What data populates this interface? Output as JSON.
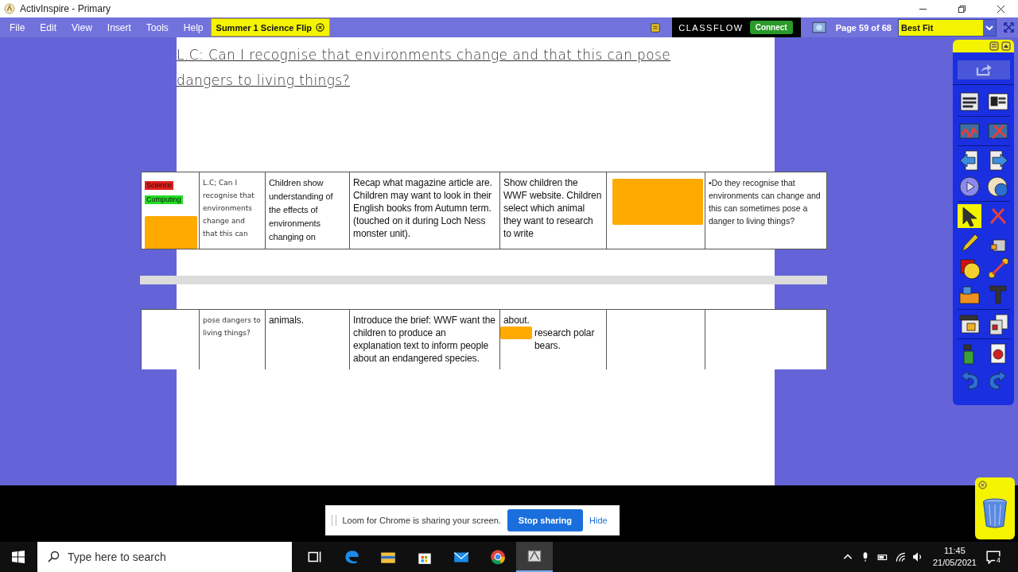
{
  "window": {
    "title": "ActivInspire - Primary"
  },
  "menu": [
    "File",
    "Edit",
    "View",
    "Insert",
    "Tools",
    "Help"
  ],
  "flipchart_tab": {
    "label": "Summer 1 Science Flip"
  },
  "classflow": {
    "logo": "CLASSFLOW",
    "button": "Connect"
  },
  "page_indicator": "Page 59 of 68",
  "zoom_select": {
    "value": "Best Fit"
  },
  "page": {
    "title_lines": [
      "L.C: Can I recognise that environments change and that this can pose",
      "dangers to living things? "
    ]
  },
  "tables": [
    {
      "cells": [
        {
          "kind": "tags",
          "tags": [
            {
              "label": "Science",
              "color": "#e0201c"
            },
            {
              "label": "Computing",
              "color": "#22dd22"
            }
          ]
        },
        {
          "kind": "handwriting",
          "text": "L.C; Can I recognise that environments change and that this can"
        },
        {
          "kind": "text",
          "text": "Children show understanding of the effects of environments changing on"
        },
        {
          "kind": "text",
          "text": "Recap what magazine article are. Children may want to look in their English books from Autumn term. (touched on it during Loch Ness monster unit)."
        },
        {
          "kind": "text",
          "text": "Show children the WWF website. Children select which animal they want to research to write"
        },
        {
          "kind": "block"
        },
        {
          "kind": "calibri",
          "text": "•Do they recognise that environments can change and this can sometimes pose a danger to living things?"
        }
      ]
    },
    {
      "cells": [
        {
          "kind": "empty"
        },
        {
          "kind": "handwriting",
          "text": "pose dangers to living things?"
        },
        {
          "kind": "text",
          "text": "animals."
        },
        {
          "kind": "text",
          "text": "Introduce the brief: WWF want the children to produce an explanation text to inform people about an endangered species."
        },
        {
          "kind": "mixed",
          "before": "about.",
          "after": "research polar bears."
        },
        {
          "kind": "empty"
        },
        {
          "kind": "empty"
        }
      ]
    }
  ],
  "toolbox": {
    "tools": [
      {
        "selected": false
      },
      {
        "selected": false
      },
      {
        "selected": false
      },
      {
        "selected": false
      },
      {
        "selected": false
      },
      {
        "selected": false
      },
      {
        "selected": false
      },
      {
        "selected": false
      },
      {
        "selected": true
      },
      {
        "selected": false
      },
      {
        "selected": false
      },
      {
        "selected": false
      },
      {
        "selected": false
      },
      {
        "selected": false
      },
      {
        "selected": false
      },
      {
        "selected": false
      },
      {
        "selected": false
      },
      {
        "selected": false
      },
      {
        "selected": false
      },
      {
        "selected": false
      },
      {
        "selected": false
      },
      {
        "selected": false
      }
    ]
  },
  "sharing_bar": {
    "message": "Loom for Chrome is sharing your screen.",
    "stop_button": "Stop sharing",
    "hide_link": "Hide"
  },
  "taskbar": {
    "search_placeholder": "Type here to search",
    "time": "11:45",
    "date": "21/05/2021",
    "notifications": "4"
  }
}
